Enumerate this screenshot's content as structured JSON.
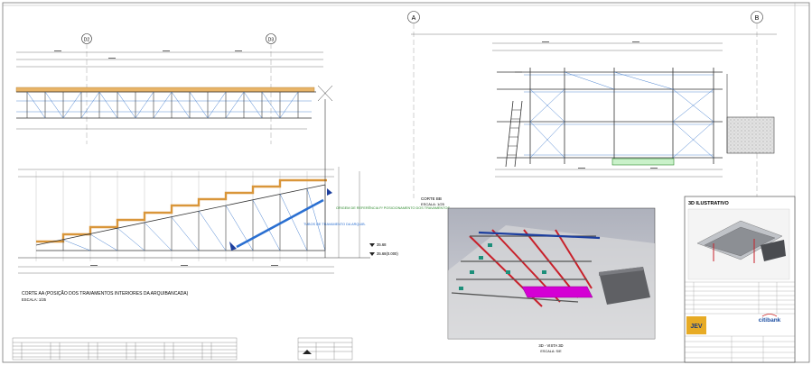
{
  "grid": {
    "D2": "D2",
    "D3": "D3",
    "A": "A",
    "B": "B"
  },
  "notes": {
    "cut_title": "CORTE AA (POSIÇÃO DOS TRAVAMENTOS INTERIORES DA ARQUIBANCADA)",
    "cut_scale": "ESCALA: 1/25",
    "cut_bb_title": "CORTE BB",
    "cut_bb_scale": "ESCALA: 1/25",
    "ref_green": "ORIGEM DE REFERÊNCIA P/ POSICIONAMENTO DOS TRAVAMENTOS",
    "blue_note": "TUBOS DE TRAVAMENTO DA ARQUIB.",
    "level_1": "35.68",
    "level_2": "35.68(0.000)",
    "photo_caption": "3D - VISTA 3D",
    "photo_caption_scale": "ESCALA: S/E"
  },
  "title_block": {
    "section_3d": "3D ILUSTRATIVO",
    "brand_jev": "JEV",
    "brand_citibank": "citibank"
  },
  "colors": {
    "line": "#222222",
    "dim": "#555555",
    "blue_member": "#2a6fd1",
    "orange": "#e0a24a",
    "green": "#2e8b2e",
    "magenta": "#d400d4",
    "red_frame": "#c8202a",
    "photo_bg": "#b9bcc6"
  }
}
